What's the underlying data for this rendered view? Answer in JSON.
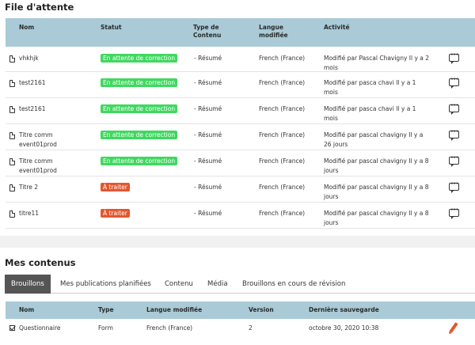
{
  "queue": {
    "title": "File d'attente",
    "headers": [
      "Nom",
      "Statut",
      "Type de\nContenu",
      "Langue\nmodifiée",
      "Activité"
    ],
    "rows": [
      {
        "name": "vhkhjk",
        "status": "En attente de correction",
        "status_color": "#3fd85f",
        "type": "- Résumé",
        "lang": "French (France)",
        "activity": "Modifié par Pascal Chavigny Il y a 2\nmois"
      },
      {
        "name": "test2161",
        "status": "En attente de correction",
        "status_color": "#3fd85f",
        "type": "- Résumé",
        "lang": "French (France)",
        "activity": "Modifié par pasca chavi Il y a 1\nmois"
      },
      {
        "name": "test2161",
        "status": "En attente de correction",
        "status_color": "#3fd85f",
        "type": "- Résumé",
        "lang": "French (France)",
        "activity": "Modifié par pasca chavi Il y a 1\nmois"
      },
      {
        "name": "Titre comm\nevent01prod",
        "status": "En attente de correction",
        "status_color": "#3fd85f",
        "type": "- Résumé",
        "lang": "French (France)",
        "activity": "Modifié par pascal chavigny Il y a\n26 jours"
      },
      {
        "name": "Titre comm\nevent01prod",
        "status": "En attente de correction",
        "status_color": "#3fd85f",
        "type": "- Résumé",
        "lang": "French (France)",
        "activity": "Modifié par pascal chavigny Il y a 8\njours"
      },
      {
        "name": "Titre 2",
        "status": "À traiter",
        "status_color": "#e4572e",
        "type": "- Résumé",
        "lang": "French (France)",
        "activity": "Modifié par pascal chavigny Il y a 8\njours"
      },
      {
        "name": "titre11",
        "status": "À traiter",
        "status_color": "#e4572e",
        "type": "- Résumé",
        "lang": "French (France)",
        "activity": "Modifié par pascal chavigny Il y a 8\njours"
      }
    ]
  },
  "contents": {
    "title": "Mes contenus",
    "tabs": [
      "Brouillons",
      "Mes publications planifiées",
      "Contenu",
      "Média",
      "Brouillons en cours de révision"
    ],
    "active_tab": "Brouillons",
    "headers": [
      "Nom",
      "Type",
      "Langue modifiée",
      "Version",
      "Dernière sauvegarde"
    ],
    "rows": [
      {
        "name": "Questionnaire",
        "type": "Form",
        "lang": "French (France)",
        "version": "2",
        "saved": "octobre 30, 2020 10:38"
      }
    ]
  },
  "icons": {
    "doc": "document-icon",
    "comment": "comment-icon",
    "edit": "pencil-icon",
    "check": "checkbox-icon"
  },
  "colors": {
    "header_bg": "#a9cad6",
    "badge_waiting": "#3fd85f",
    "badge_todo": "#e4572e",
    "tab_active": "#555555"
  }
}
